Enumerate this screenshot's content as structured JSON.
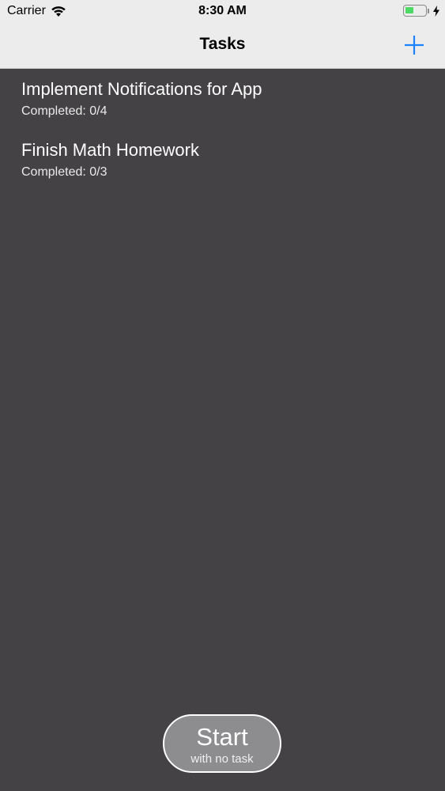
{
  "status_bar": {
    "carrier": "Carrier",
    "time": "8:30 AM",
    "battery_level": 0.45
  },
  "nav": {
    "title": "Tasks",
    "add_icon": "plus-icon",
    "accent_color": "#1a82fb"
  },
  "tasks": [
    {
      "title": "Implement Notifications for App",
      "subtitle": "Completed: 0/4"
    },
    {
      "title": "Finish Math Homework",
      "subtitle": "Completed: 0/3"
    }
  ],
  "start_button": {
    "label": "Start",
    "sublabel": "with no task"
  },
  "colors": {
    "background": "#444244",
    "nav_background": "#ececec",
    "battery_green": "#4cd964"
  }
}
